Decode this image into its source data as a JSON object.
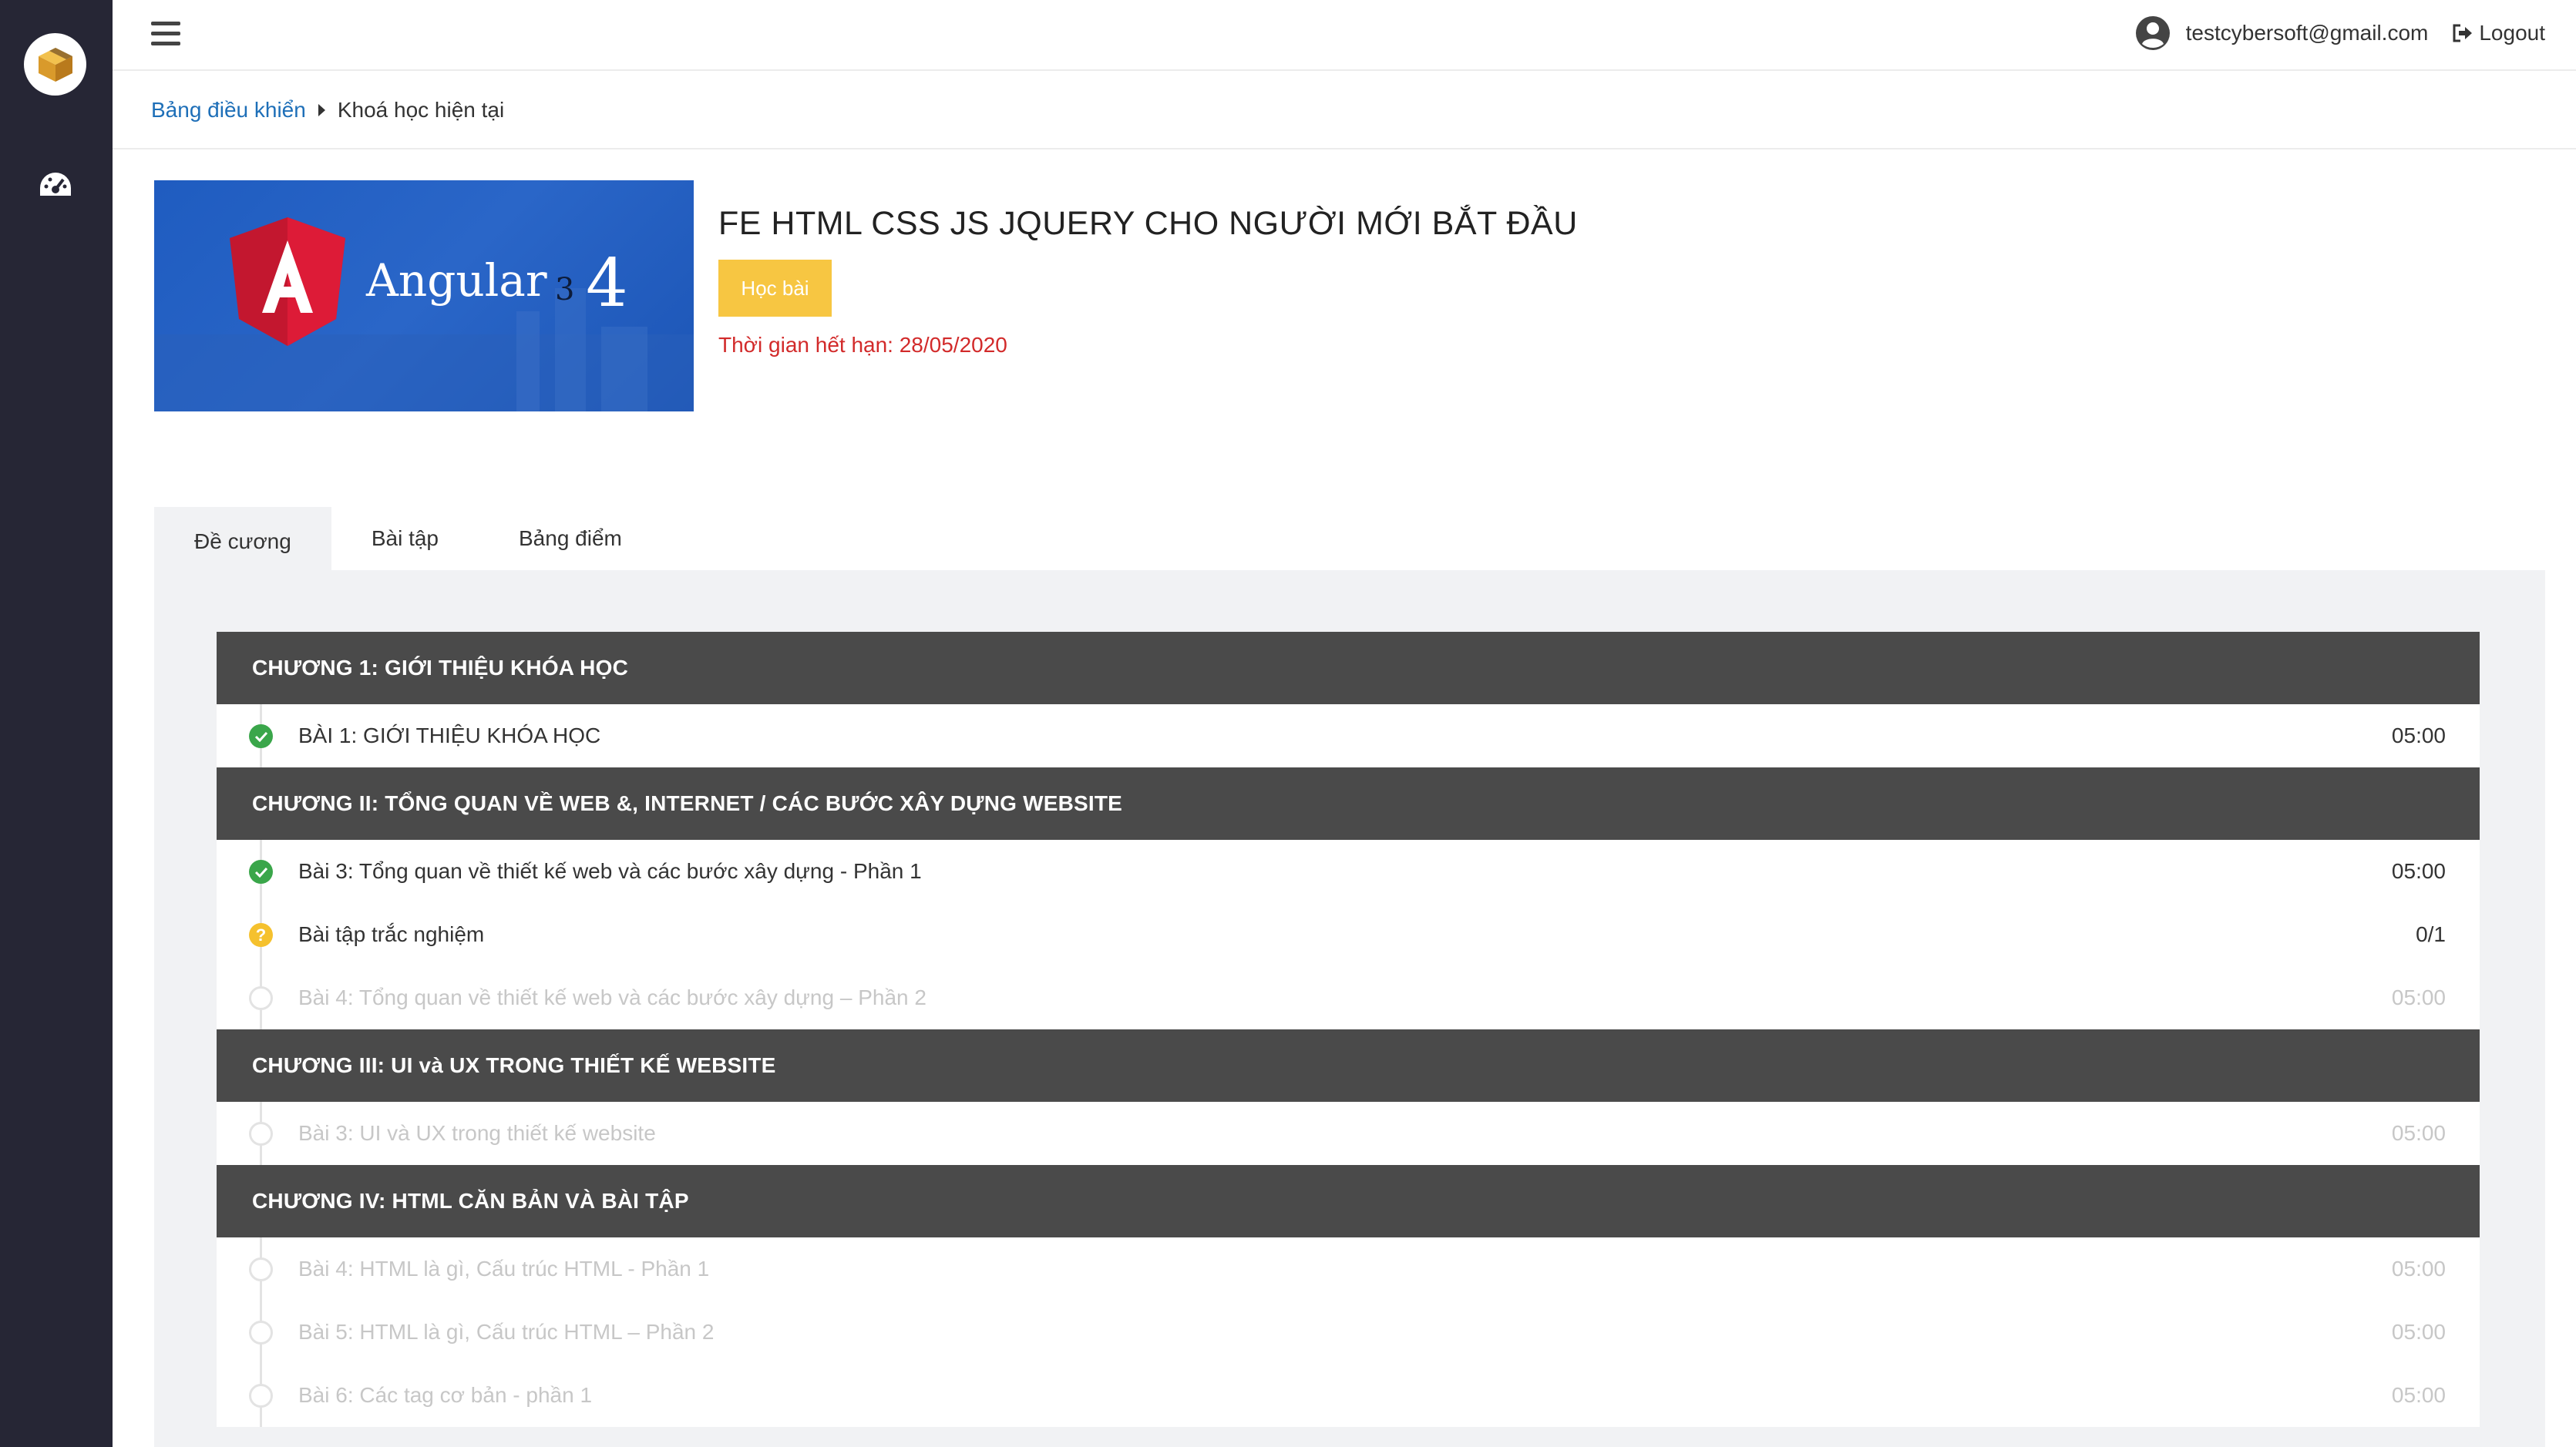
{
  "topbar": {
    "user_email": "testcybersoft@gmail.com",
    "logout_label": "Logout"
  },
  "breadcrumb": {
    "home": "Bảng điều khiển",
    "current": "Khoá học hiện tại"
  },
  "course": {
    "thumbnail_text": "Angular",
    "thumbnail_version_small": "3",
    "thumbnail_version": "4",
    "title": "FE HTML CSS JS JQUERY CHO NGƯỜI MỚI BẮT ĐẦU",
    "learn_button": "Học bài",
    "expire_text": "Thời gian hết hạn: 28/05/2020"
  },
  "tabs": [
    {
      "label": "Đề cương",
      "active": true
    },
    {
      "label": "Bài tập",
      "active": false
    },
    {
      "label": "Bảng điểm",
      "active": false
    }
  ],
  "outline": [
    {
      "chapter": "CHƯƠNG 1: GIỚI THIỆU KHÓA HỌC",
      "lessons": [
        {
          "name": "BÀI 1: GIỚI THIỆU KHÓA HỌC",
          "value": "05:00",
          "status": "done"
        }
      ]
    },
    {
      "chapter": "CHƯƠNG II: TỔNG QUAN VỀ WEB &, INTERNET / CÁC BƯỚC XÂY DỰNG WEBSITE",
      "lessons": [
        {
          "name": "Bài 3: Tổng quan về thiết kế web và các bước xây dựng - Phần 1",
          "value": "05:00",
          "status": "done"
        },
        {
          "name": "Bài tập trắc nghiệm",
          "value": "0/1",
          "status": "quiz"
        },
        {
          "name": "Bài 4: Tổng quan về thiết kế web và các bước xây dựng – Phần 2",
          "value": "05:00",
          "status": "locked"
        }
      ]
    },
    {
      "chapter": "CHƯƠNG III: UI và UX TRONG THIẾT KẾ WEBSITE",
      "lessons": [
        {
          "name": "Bài 3: UI và UX trong thiết kế website",
          "value": "05:00",
          "status": "locked"
        }
      ]
    },
    {
      "chapter": "CHƯƠNG IV: HTML CĂN BẢN VÀ BÀI TẬP",
      "lessons": [
        {
          "name": "Bài 4: HTML là gì, Cấu trúc HTML - Phần 1",
          "value": "05:00",
          "status": "locked"
        },
        {
          "name": "Bài 5: HTML là gì, Cấu trúc HTML – Phần 2",
          "value": "05:00",
          "status": "locked"
        },
        {
          "name": "Bài 6: Các tag cơ bản - phần 1",
          "value": "05:00",
          "status": "locked"
        }
      ]
    }
  ],
  "colors": {
    "sidebar": "#262635",
    "accent_link": "#1e6fb8",
    "button_yellow": "#f7c642",
    "expire_red": "#d22a2a",
    "chapter_bg": "#4a4a4a",
    "done_green": "#3aa64a"
  }
}
